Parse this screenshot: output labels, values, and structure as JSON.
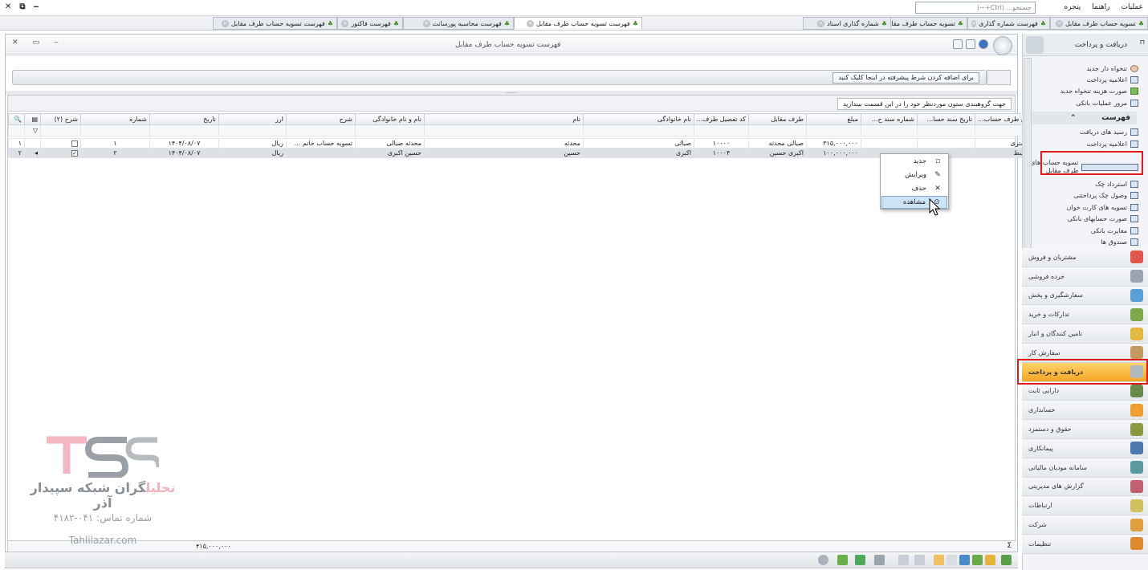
{
  "menubar": {
    "items": [
      "عملیات",
      "راهنما",
      "پنجره"
    ],
    "search_placeholder": "جستجو... (Ctrl+~)"
  },
  "tabs": [
    {
      "label": "فهرست تسویه حساب طرف مقابل",
      "active": true
    },
    {
      "label": "فهرست محاسبه پورسانت"
    },
    {
      "label": "فهرست فاکتور"
    },
    {
      "label": "فهرست تسویه حساب طرف مقابل"
    },
    {
      "label": "تسویه حساب طرف مقابل"
    },
    {
      "label": "شماره گذاری اسناد"
    },
    {
      "label": "فهرست شماره گذاری"
    },
    {
      "label": "تسویه حساب طرف مقابل"
    }
  ],
  "window": {
    "title": "فهرست تسویه حساب طرف مقابل"
  },
  "filter": {
    "add_condition": "برای اضافه کردن شرط پیشرفته در اینجا کلیک کنید"
  },
  "grid": {
    "group_hint": "جهت گروهبندی ستون موردنظر خود را در این قسمت بیندازید",
    "columns": [
      "شرح (۲)",
      "شماره",
      "تاریخ",
      "ارز",
      "شرح",
      "نام و نام خانوادگی",
      "نام",
      "نام خانوادگی",
      "کد تفصیل طرف...",
      "طرف مقابل",
      "مبلغ",
      "شماره سند ح...",
      "تاریخ سند حسا...",
      "نوع طرف حساب..."
    ],
    "rows": [
      {
        "idx": "۱",
        "checked": "",
        "number": "۱",
        "date": "۱۴۰۴/۰۸/۰۷",
        "currency": "ریال",
        "desc": "تسویه حساب خانم ...",
        "fullname": "محدثه صیالی",
        "name": "محدثه",
        "family": "صیالی",
        "code": "۱۰۰۰۰",
        "party": "صیالی محدثه",
        "amount": "۳۱۵,۰۰۰,۰۰۰",
        "docno": "",
        "docdate": "",
        "type": "مشتری"
      },
      {
        "idx": "۲",
        "checked": "✓",
        "number": "۲",
        "date": "۱۴۰۴/۰۸/۰۷",
        "currency": "ریال",
        "desc": "",
        "fullname": "حسین اکبری",
        "name": "حسین",
        "family": "اکبری",
        "code": "۱۰۰۰۴",
        "party": "اکبری حسین",
        "amount": "۱۰۰,۰۰۰,۰۰۰",
        "docno": "",
        "docdate": "",
        "type": "واسط"
      }
    ],
    "total": "۴۱۵,۰۰۰,۰۰۰",
    "sigma": "Σ"
  },
  "context_menu": [
    {
      "label": "جدید",
      "icon": "new-icon"
    },
    {
      "label": "ویرایش",
      "icon": "edit-icon"
    },
    {
      "label": "حذف",
      "icon": "delete-icon"
    },
    {
      "label": "مشاهده",
      "icon": "view-icon",
      "highlighted": true
    }
  ],
  "sidebar": {
    "title": "دریافت و پرداخت",
    "top_items": [
      "تنخواه دار جدید",
      "اعلامیه پرداخت",
      "صورت هزینه تنخواه جدید",
      "مرور عملیات بانکی"
    ],
    "section": "فهرست",
    "list_items": [
      "رسید های دریافت",
      "اعلامیه پرداخت",
      "تسویه حساب های طرف مقابل",
      "استرداد چک",
      "وصول چک پرداختنی",
      "تسویه های کارت خوان",
      "صورت حسابهای بانکی",
      "مغایرت بانکی",
      "صندوق ها"
    ],
    "modules": [
      {
        "label": "مشتریان و فروش",
        "color": "#e0564a"
      },
      {
        "label": "خرده فروشی",
        "color": "#9aa4b0"
      },
      {
        "label": "سفارشگیری و پخش",
        "color": "#5aa0d8"
      },
      {
        "label": "تدارکات و خرید",
        "color": "#7aa84a"
      },
      {
        "label": "تامین کنندگان و انبار",
        "color": "#e2b640"
      },
      {
        "label": "سفارش کار",
        "color": "#c49a60"
      },
      {
        "label": "دریافت و پرداخت",
        "color": "#b0b8c0",
        "active": true
      },
      {
        "label": "دارایی ثابت",
        "color": "#6a8a4a"
      },
      {
        "label": "حسابداری",
        "color": "#f0a030"
      },
      {
        "label": "حقوق و دستمزد",
        "color": "#8a9a40"
      },
      {
        "label": "پیمانکاری",
        "color": "#4a7ab0"
      },
      {
        "label": "سامانه مودیان مالیاتی",
        "color": "#5a9aa0"
      },
      {
        "label": "گزارش های مدیریتی",
        "color": "#c06070"
      },
      {
        "label": "ارتباطات",
        "color": "#d0c060"
      },
      {
        "label": "شرکت",
        "color": "#e0a040"
      },
      {
        "label": "تنظیمات",
        "color": "#e08a30"
      }
    ]
  },
  "watermark": {
    "brand_part1": "تحلیل",
    "brand_part2": "گران شبکه سپیدار آذر",
    "phone": "شماره تماس: ۰۴۱-۴۱۸۲",
    "site": "Tahlilazar.com"
  }
}
